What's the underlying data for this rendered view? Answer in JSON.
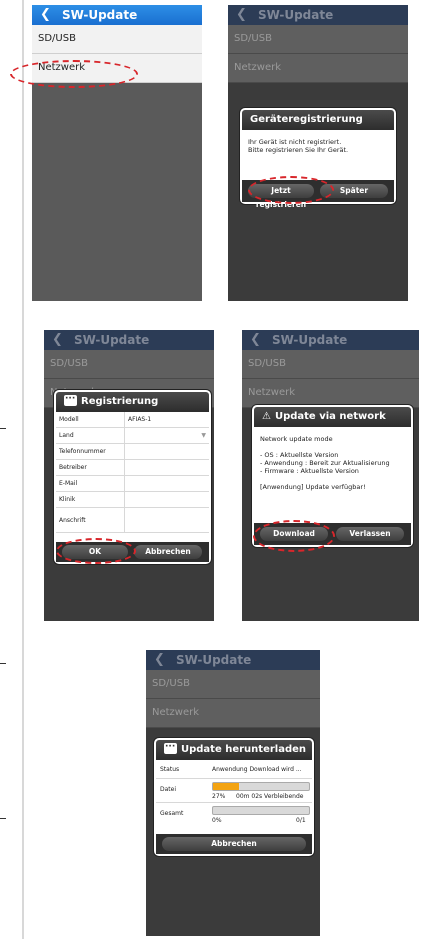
{
  "screen1": {
    "title": "SW-Update",
    "items": [
      "SD/USB",
      "Netzwerk"
    ]
  },
  "screen2": {
    "title": "SW-Update",
    "items": [
      "SD/USB",
      "Netzwerk"
    ],
    "dialog": {
      "title": "Geräteregistrierung",
      "line1": "Ihr Gerät ist nicht registriert.",
      "line2": "Bitte registrieren Sie Ihr Gerät.",
      "btn_register": "Jetzt registrieren",
      "btn_later": "Später"
    }
  },
  "screen3": {
    "title": "SW-Update",
    "items": [
      "SD/USB",
      "Netzwerk"
    ],
    "dialog": {
      "title": "Registrierung",
      "fields": [
        {
          "label": "Modell",
          "value": "AFIAS-1"
        },
        {
          "label": "Land",
          "value": ""
        },
        {
          "label": "Telefonnummer",
          "value": ""
        },
        {
          "label": "Betreiber",
          "value": ""
        },
        {
          "label": "E-Mail",
          "value": ""
        },
        {
          "label": "Klinik",
          "value": ""
        },
        {
          "label": "Anschrift",
          "value": ""
        }
      ],
      "btn_ok": "OK",
      "btn_cancel": "Abbrechen"
    }
  },
  "screen4": {
    "title": "SW-Update",
    "items": [
      "SD/USB",
      "Netzwerk"
    ],
    "dialog": {
      "title": "Update via network",
      "mode": "Network update mode",
      "l1": "- OS : Aktuellste Version",
      "l2": "- Anwendung : Bereit zur Aktualisierung",
      "l3": "- Firmware : Aktuellste Version",
      "avail": "[Anwendung] Update verfügbar!",
      "btn_download": "Download",
      "btn_leave": "Verlassen"
    }
  },
  "screen5": {
    "title": "SW-Update",
    "items": [
      "SD/USB",
      "Netzwerk"
    ],
    "dialog": {
      "title": "Update herunterladen",
      "status_label": "Status",
      "status_value": "Anwendung Download wird ...",
      "file_label": "Datei",
      "file_percent": "27%",
      "file_remaining": "00m 02s Verbleibende",
      "file_progress": 0.27,
      "total_label": "Gesamt",
      "total_percent": "0%",
      "total_count": "0/1",
      "total_progress": 0.0,
      "btn_cancel": "Abbrechen"
    }
  },
  "colors": {
    "titlebar_active": "#1a6fd0",
    "highlight": "#d8262b",
    "progress": "#f3a312"
  }
}
